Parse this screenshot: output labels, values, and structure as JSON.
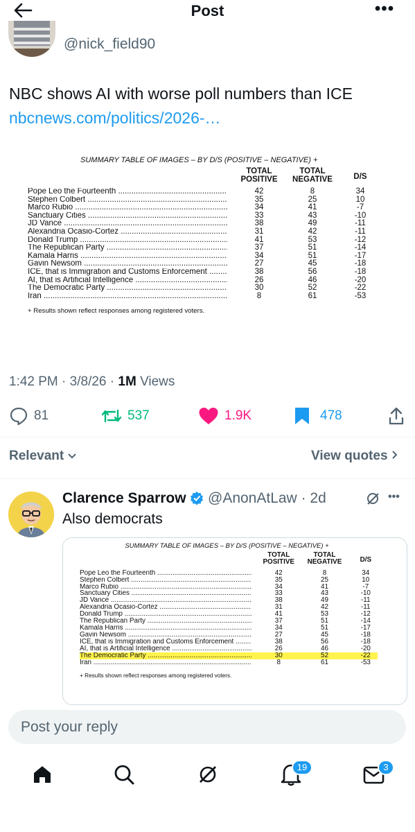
{
  "header": {
    "title": "Post"
  },
  "tweet": {
    "handle": "@nick_field90",
    "text": "NBC shows AI with worse poll numbers than ICE",
    "link": "nbcnews.com/politics/2026-…",
    "time": "1:42 PM",
    "date": "3/8/26",
    "views_count": "1M",
    "views_label": "Views",
    "replies": "81",
    "reposts": "537",
    "likes": "1.9K",
    "bookmarks": "478"
  },
  "poll_table": {
    "title": "SUMMARY TABLE OF IMAGES – BY D/S (POSITIVE – NEGATIVE) +",
    "col_total": "TOTAL",
    "col_positive": "POSITIVE",
    "col_negative": "NEGATIVE",
    "col_ds": "D/S",
    "footnote": "+ Results shown reflect responses among registered voters.",
    "rows": [
      {
        "label": "Pope Leo the Fourteenth",
        "pos": "42",
        "neg": "8",
        "ds": "34"
      },
      {
        "label": "Stephen Colbert",
        "pos": "35",
        "neg": "25",
        "ds": "10"
      },
      {
        "label": "Marco Rubio",
        "pos": "34",
        "neg": "41",
        "ds": "-7"
      },
      {
        "label": "Sanctuary Cities",
        "pos": "33",
        "neg": "43",
        "ds": "-10"
      },
      {
        "label": "JD Vance",
        "pos": "38",
        "neg": "49",
        "ds": "-11"
      },
      {
        "label": "Alexandria Ocasio-Cortez",
        "pos": "31",
        "neg": "42",
        "ds": "-11"
      },
      {
        "label": "Donald Trump",
        "pos": "41",
        "neg": "53",
        "ds": "-12"
      },
      {
        "label": "The Republican Party",
        "pos": "37",
        "neg": "51",
        "ds": "-14"
      },
      {
        "label": "Kamala Harris",
        "pos": "34",
        "neg": "51",
        "ds": "-17"
      },
      {
        "label": "Gavin Newsom",
        "pos": "27",
        "neg": "45",
        "ds": "-18"
      },
      {
        "label": "ICE, that is Immigration and Customs Enforcement",
        "pos": "38",
        "neg": "56",
        "ds": "-18"
      },
      {
        "label": "AI, that is Artificial Intelligence",
        "pos": "26",
        "neg": "46",
        "ds": "-20"
      },
      {
        "label": "The Democratic Party",
        "pos": "30",
        "neg": "52",
        "ds": "-22"
      },
      {
        "label": "Iran",
        "pos": "8",
        "neg": "61",
        "ds": "-53"
      }
    ]
  },
  "sort": {
    "relevant": "Relevant",
    "view_quotes": "View quotes"
  },
  "reply": {
    "name": "Clarence Sparrow",
    "handle": "@AnonAtLaw",
    "age": "· 2d",
    "text": "Also democrats",
    "highlight_row": "The Democratic Party",
    "highlight_color": "#fff34d"
  },
  "composer": {
    "placeholder": "Post your reply"
  },
  "tabbar": {
    "notifications_badge": "19",
    "messages_badge": "3"
  },
  "colors": {
    "accent": "#1d9bf0",
    "repost": "#00ba7c",
    "like": "#f91880",
    "muted": "#536471"
  }
}
